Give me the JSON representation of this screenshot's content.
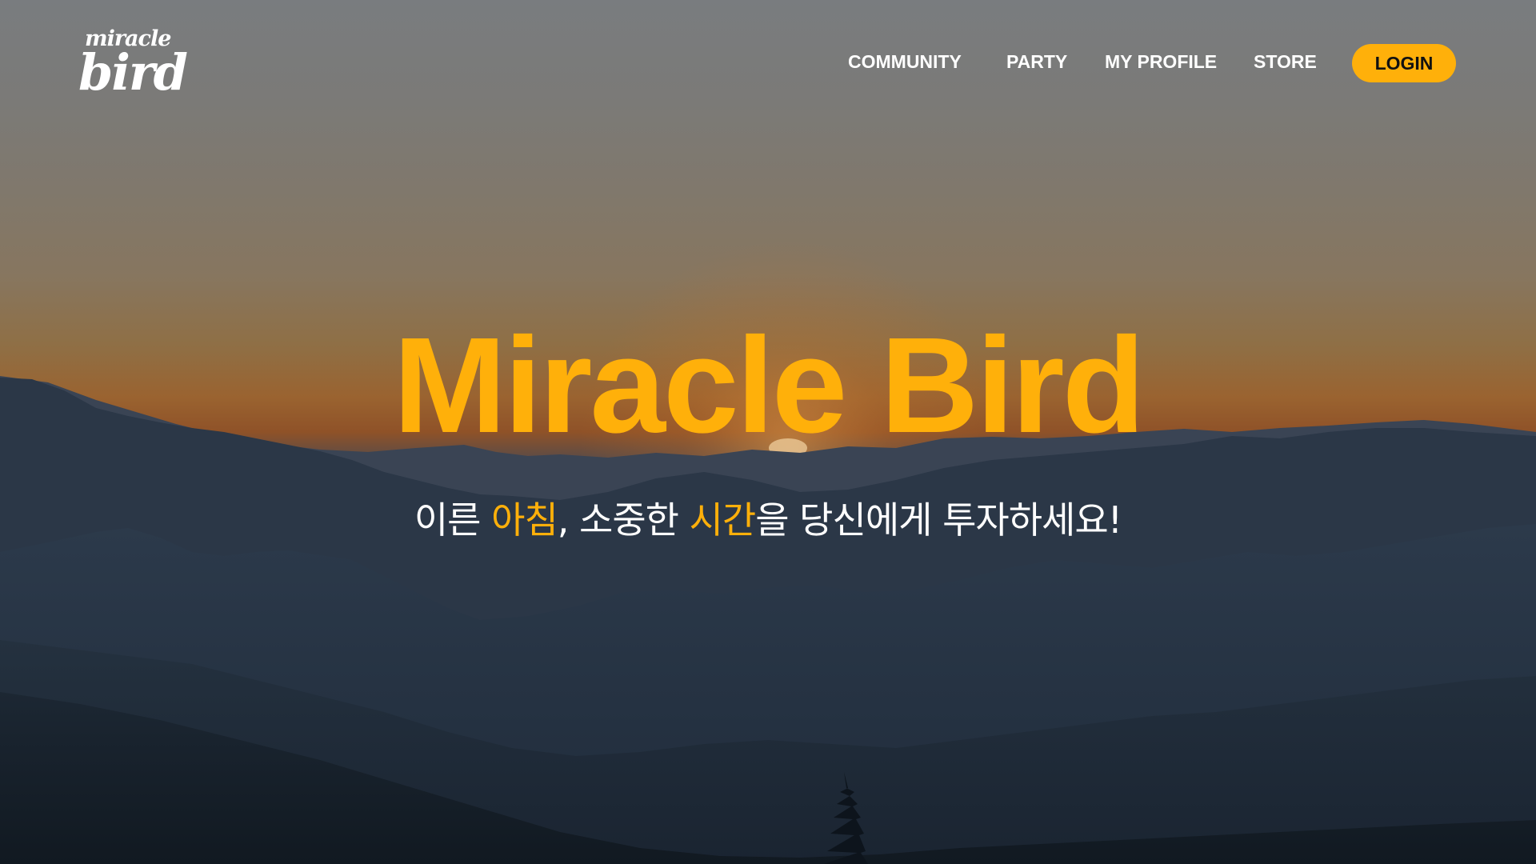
{
  "brand": {
    "logo_top": "miracle",
    "logo_bottom": "bird"
  },
  "nav": {
    "items": [
      {
        "label": "COMMUNITY"
      },
      {
        "label": "PARTY"
      },
      {
        "label": "MY PROFILE"
      },
      {
        "label": "STORE"
      }
    ],
    "login_label": "LOGIN"
  },
  "hero": {
    "title": "Miracle Bird",
    "subtitle_parts": [
      {
        "text": "이른 ",
        "highlight": false
      },
      {
        "text": "아침",
        "highlight": true
      },
      {
        "text": ", 소중한 ",
        "highlight": false
      },
      {
        "text": "시간",
        "highlight": true
      },
      {
        "text": "을 당신에게 투자하세요!",
        "highlight": false
      }
    ]
  },
  "colors": {
    "accent": "#ffb00a",
    "text_light": "#ffffff",
    "button_text": "#111111"
  }
}
